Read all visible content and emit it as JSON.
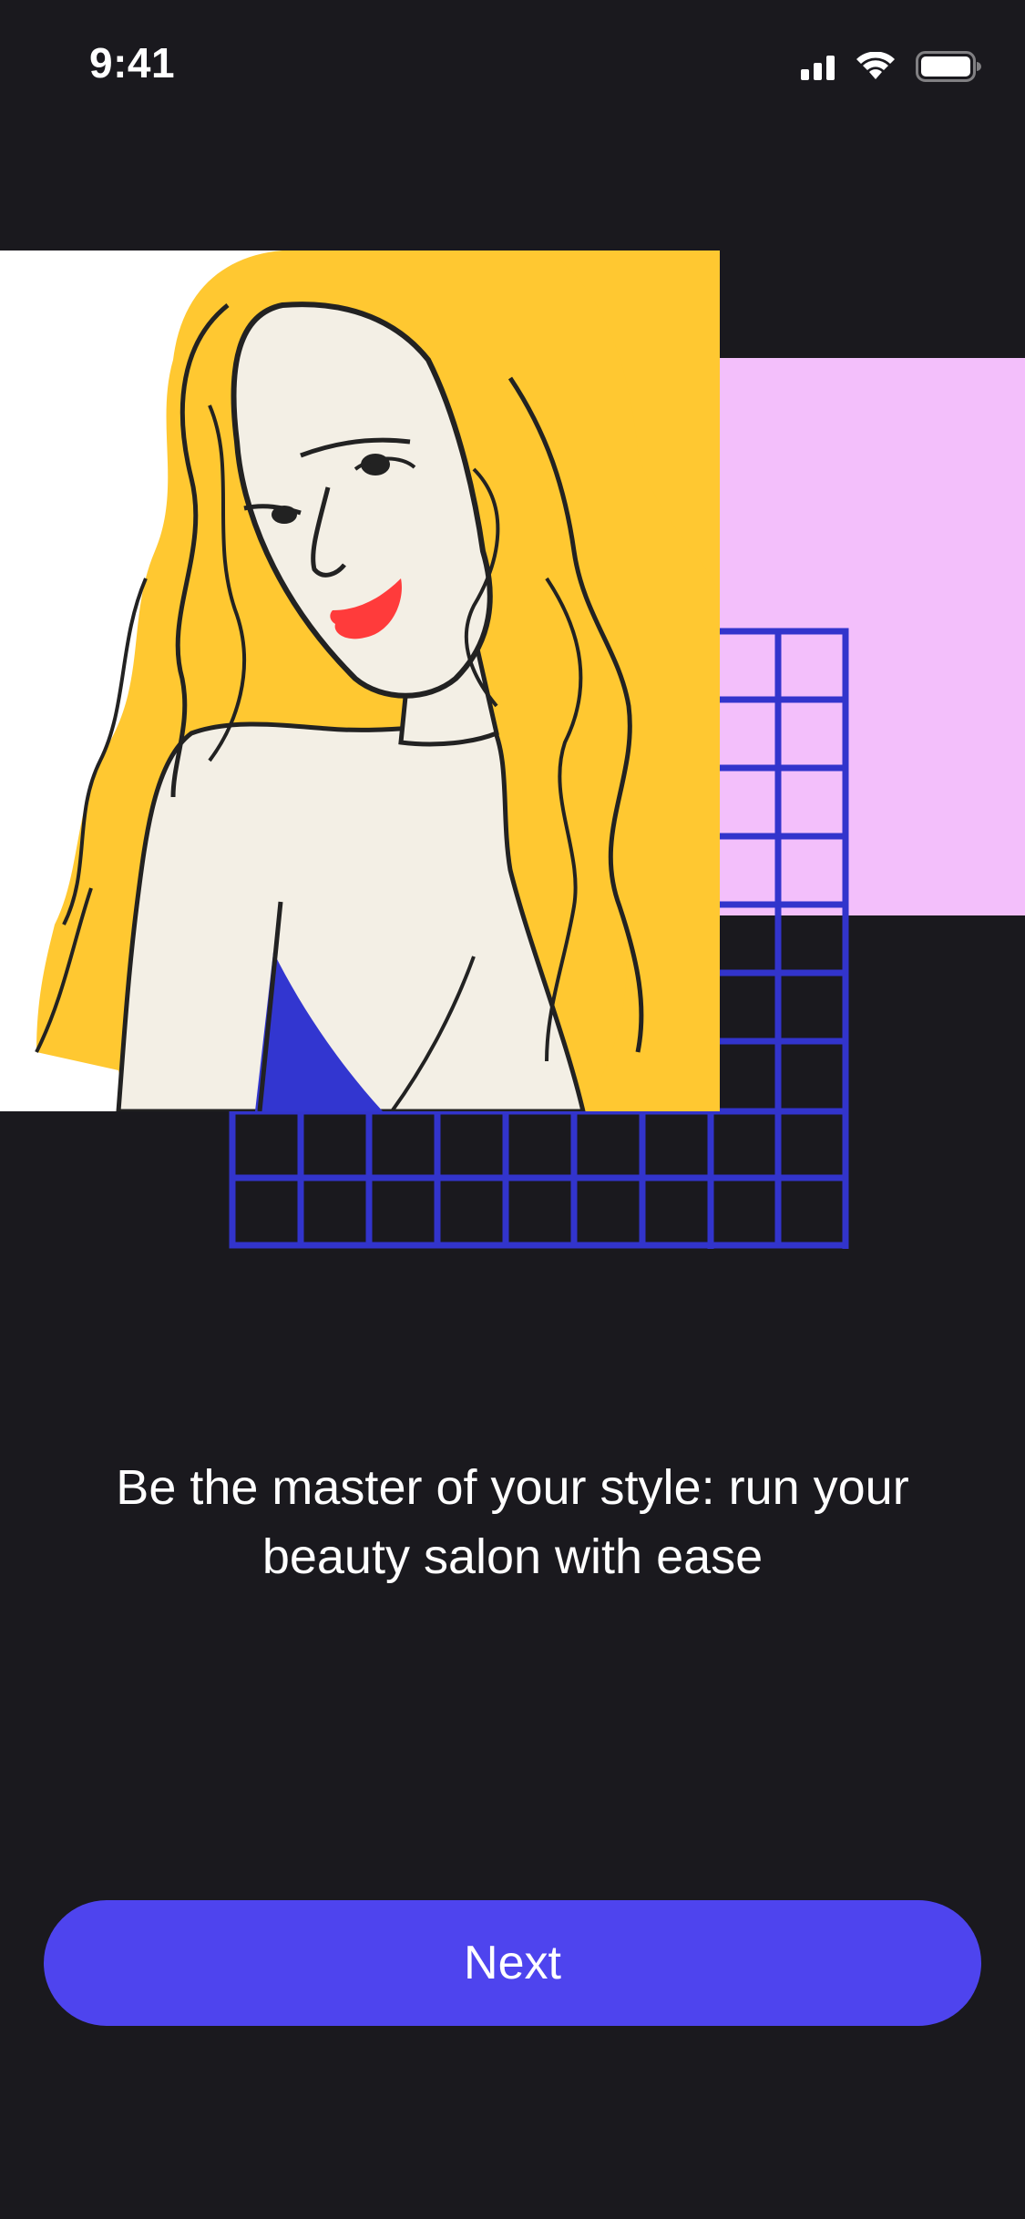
{
  "status_bar": {
    "time": "9:41",
    "icons": [
      "signal-icon",
      "wifi-icon",
      "battery-icon"
    ]
  },
  "illustration": {
    "subject": "woman-portrait-illustration",
    "colors": {
      "hair": "#FFC831",
      "skin": "#F3EFE5",
      "lips": "#FF3B3B",
      "dress": "#3236D0",
      "grid": "#3234CC",
      "pink_block": "#F3BFFB",
      "card_bg": "#FFFFFF"
    }
  },
  "onboarding": {
    "headline": "Be the master of your style: run your beauty salon with ease",
    "next_label": "Next"
  },
  "theme": {
    "background": "#1A191E",
    "accent": "#4E44EE",
    "text": "#FFFFFF"
  }
}
